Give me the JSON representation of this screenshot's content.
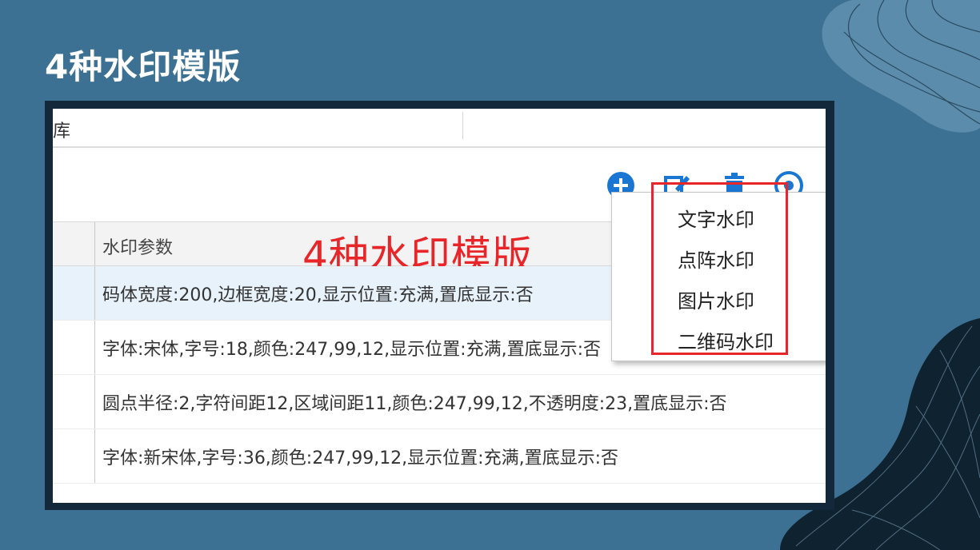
{
  "slide": {
    "title": "4种水印模版"
  },
  "app": {
    "top_tab_label": "库",
    "toolbar": {
      "add_icon": "plus-circle-icon",
      "edit_icon": "edit-icon",
      "delete_icon": "trash-icon",
      "help_icon": "help-circle-icon",
      "accent_color": "#1976d2"
    },
    "grid": {
      "column_header": "水印参数",
      "annotation": "4种水印模版",
      "rows": [
        {
          "params": "码体宽度:200,边框宽度:20,显示位置:充满,置底显示:否"
        },
        {
          "params": "字体:宋体,字号:18,颜色:247,99,12,显示位置:充满,置底显示:否"
        },
        {
          "params": "圆点半径:2,字符间距12,区域间距11,颜色:247,99,12,不透明度:23,置底显示:否"
        },
        {
          "params": "字体:新宋体,字号:36,颜色:247,99,12,显示位置:充满,置底显示:否"
        }
      ]
    },
    "add_menu": {
      "items": [
        "文字水印",
        "点阵水印",
        "图片水印",
        "二维码水印"
      ],
      "highlight_color": "#e8262a"
    }
  }
}
